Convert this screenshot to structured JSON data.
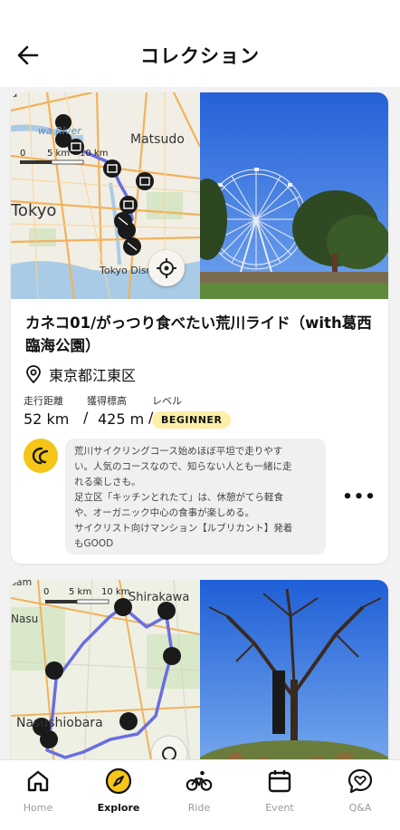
{
  "header": {
    "title": "コレクション"
  },
  "cards": [
    {
      "map": {
        "labels": {
          "river": "wa River",
          "city1": "Matsudo",
          "city2": "Tokyo",
          "poi": "Tokyo Disn  and",
          "top": "a"
        },
        "scale_labels": [
          "0",
          "5 km",
          "10 km"
        ]
      },
      "title": "カネコ01/がっつり食べたい荒川ライド（with葛西臨海公園）",
      "location": "東京都江東区",
      "stats": {
        "distance_label": "走行距離",
        "elevation_label": "獲得標高",
        "level_label": "レベル",
        "distance": "52 km",
        "elevation": "425 m",
        "level": "BEGINNER"
      },
      "description": [
        "荒川サイクリングコース始めほぼ平坦で走りやす",
        "い。人気のコースなので、知らない人とも一緒に走",
        "れる楽しさも。",
        "足立区「キッチンとれたて」は、休憩がてら軽食",
        "や、オーガニック中心の食事が楽しめる。",
        "サイクリスト向けマンション【ルブリカント】発着",
        "もGOOD"
      ],
      "more": "•••"
    },
    {
      "map": {
        "labels": {
          "top": "sam",
          "city1": "Shirakawa",
          "city2": "Nasu",
          "city3": "Nasushiobara"
        },
        "scale_labels": [
          "0",
          "5 km",
          "10 km"
        ]
      }
    }
  ],
  "tabs": [
    {
      "label": "Home",
      "icon": "home-icon"
    },
    {
      "label": "Explore",
      "icon": "compass-icon",
      "active": true
    },
    {
      "label": "Ride",
      "icon": "bicycle-icon"
    },
    {
      "label": "Event",
      "icon": "calendar-icon"
    },
    {
      "label": "Q&A",
      "icon": "heart-chat-icon"
    }
  ],
  "colors": {
    "accent": "#f5c518",
    "route": "#6a6ee0",
    "badge_bg": "#fdf0a6",
    "sky": "#2f6fe0"
  }
}
